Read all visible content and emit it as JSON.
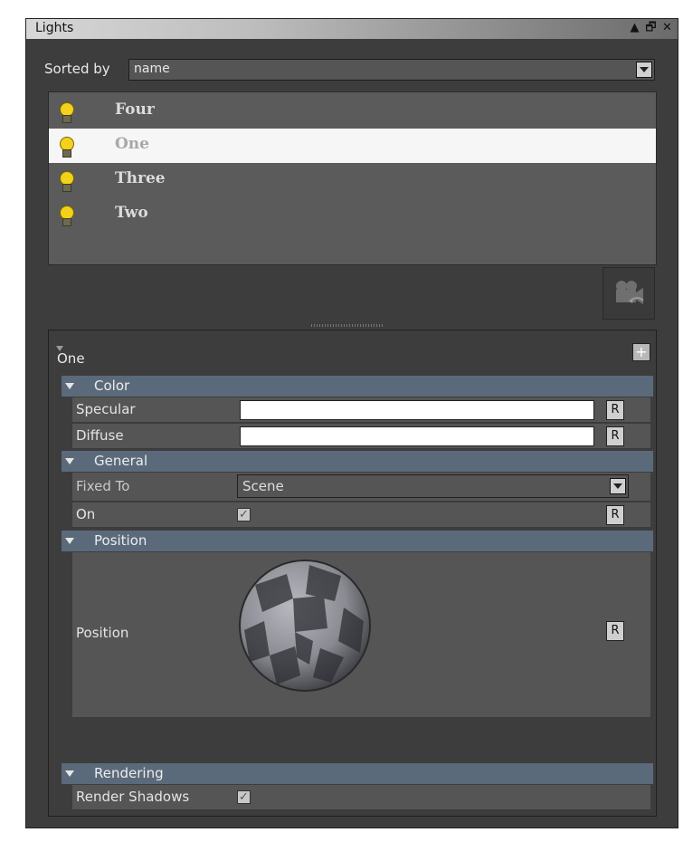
{
  "window": {
    "title": "Lights",
    "controls": [
      "▲",
      "🗗",
      "✕"
    ]
  },
  "sort": {
    "label": "Sorted by",
    "value": "name"
  },
  "lights": [
    {
      "name": "Four",
      "selected": false
    },
    {
      "name": "One",
      "selected": true
    },
    {
      "name": "Three",
      "selected": false
    },
    {
      "name": "Two",
      "selected": false
    }
  ],
  "properties": {
    "object_name": "One",
    "add_button": "+",
    "sections": {
      "color": "Color",
      "general": "General",
      "position": "Position",
      "rendering": "Rendering"
    },
    "specular": {
      "label": "Specular",
      "color": "#ffffff",
      "reset": "R"
    },
    "diffuse": {
      "label": "Diffuse",
      "color": "#ffffff",
      "reset": "R"
    },
    "fixed_to": {
      "label": "Fixed To",
      "value": "Scene"
    },
    "on": {
      "label": "On",
      "checked": true,
      "reset": "R"
    },
    "position": {
      "label": "Position",
      "reset": "R"
    },
    "render_shadows": {
      "label": "Render Shadows",
      "checked": true
    }
  },
  "icons": {
    "light_bulb": "lightbulb-icon",
    "camera_link": "camera-link-icon",
    "dropdown": "chevron-down-icon"
  },
  "colors": {
    "panel_bg": "#3d3d3d",
    "section_header": "#5a6a7a",
    "row_bg": "#555555",
    "bulb": "#f2d21a",
    "selection": "#f6f6f6"
  }
}
